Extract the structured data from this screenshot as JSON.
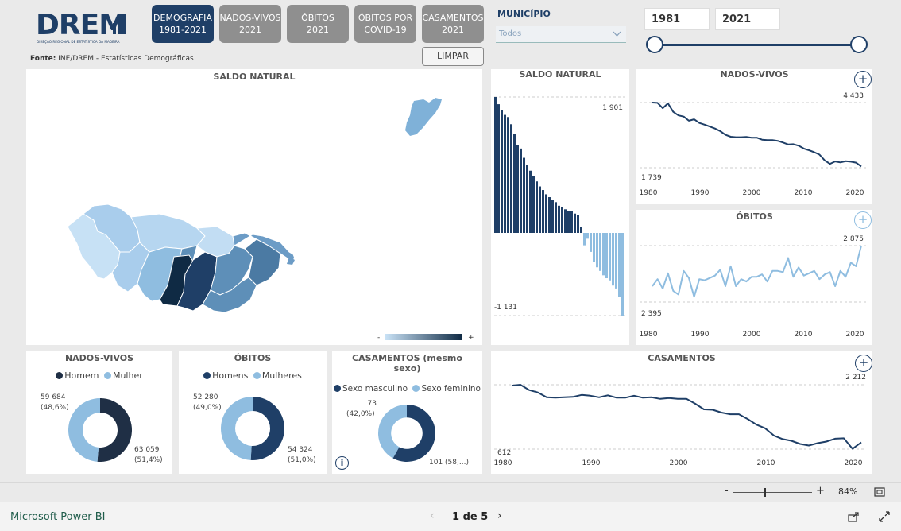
{
  "header": {
    "logo_text": "DREM",
    "logo_subtitle": "DIREÇÃO REGIONAL DE ESTATÍSTICA DA MADEIRA",
    "source_label": "Fonte:",
    "source_text": "INE/DREM - Estatísticas Demográficas",
    "nav": [
      {
        "label": "DEMOGRAFIA\n1981-2021",
        "active": true
      },
      {
        "label": "NADOS-VIVOS\n2021",
        "active": false
      },
      {
        "label": "ÓBITOS\n2021",
        "active": false
      },
      {
        "label": "ÓBITOS POR\nCOVID-19",
        "active": false
      },
      {
        "label": "CASAMENTOS\n2021",
        "active": false
      }
    ],
    "clear_label": "LIMPAR",
    "municipio_label": "MUNICÍPIO",
    "municipio_value": "Todos",
    "year_from": "1981",
    "year_to": "2021"
  },
  "map": {
    "title": "SALDO NATURAL",
    "legend_min": "-",
    "legend_max": "+",
    "colors": {
      "light": "#c9e2f6",
      "dark": "#0f2a44"
    }
  },
  "saldo": {
    "title": "SALDO NATURAL",
    "max_label": "1 901",
    "min_label": "-1 131"
  },
  "nados": {
    "title": "NADOS-VIVOS",
    "max_label": "4 433",
    "min_label": "1 739",
    "xticks": [
      "1980",
      "1990",
      "2000",
      "2010",
      "2020"
    ]
  },
  "obitos": {
    "title": "ÓBITOS",
    "max_label": "2 875",
    "min_label": "2 395",
    "xticks": [
      "1980",
      "1990",
      "2000",
      "2010",
      "2020"
    ]
  },
  "casamentos": {
    "title": "CASAMENTOS",
    "max_label": "2 212",
    "min_label": "612",
    "xticks": [
      "1980",
      "1990",
      "2000",
      "2010",
      "2020"
    ]
  },
  "donut_nados": {
    "title": "NADOS-VIVOS",
    "legend": [
      "Homem",
      "Mulher"
    ],
    "left_value": "59 684",
    "left_pct": "(48,6%)",
    "right_value": "63 059",
    "right_pct": "(51,4%)"
  },
  "donut_obitos": {
    "title": "ÓBITOS",
    "legend": [
      "Homens",
      "Mulheres"
    ],
    "left_value": "52 280",
    "left_pct": "(49,0%)",
    "right_value": "54 324",
    "right_pct": "(51,0%)"
  },
  "donut_casamentos": {
    "title": "CASAMENTOS (mesmo sexo)",
    "legend": [
      "Sexo masculino",
      "Sexo feminino"
    ],
    "left_value": "73",
    "left_pct": "(42,0%)",
    "right_value": "101 (58,...)"
  },
  "footer": {
    "brand": "Microsoft Power BI",
    "page": "1 de 5",
    "zoom": "84%"
  },
  "colors": {
    "dark": "#1f3f67",
    "light": "#8fbde0",
    "grey_btn": "#8f8f8f"
  },
  "chart_data": [
    {
      "type": "bar",
      "title": "SALDO NATURAL",
      "x": [
        1981,
        1982,
        1983,
        1984,
        1985,
        1986,
        1987,
        1988,
        1989,
        1990,
        1991,
        1992,
        1993,
        1994,
        1995,
        1996,
        1997,
        1998,
        1999,
        2000,
        2001,
        2002,
        2003,
        2004,
        2005,
        2006,
        2007,
        2008,
        2009,
        2010,
        2011,
        2012,
        2013,
        2014,
        2015,
        2016,
        2017,
        2018,
        2019,
        2020,
        2021
      ],
      "values": [
        1901,
        1800,
        1720,
        1650,
        1620,
        1520,
        1380,
        1230,
        1180,
        1050,
        950,
        870,
        790,
        720,
        650,
        600,
        540,
        500,
        460,
        430,
        380,
        360,
        330,
        310,
        300,
        270,
        250,
        80,
        -170,
        -80,
        -260,
        -400,
        -470,
        -520,
        -580,
        -620,
        -650,
        -720,
        -760,
        -880,
        -1131
      ],
      "ylim": [
        -1131,
        1901
      ]
    },
    {
      "type": "line",
      "title": "NADOS-VIVOS",
      "x": [
        1981,
        1982,
        1983,
        1984,
        1985,
        1986,
        1987,
        1988,
        1989,
        1990,
        1991,
        1992,
        1993,
        1994,
        1995,
        1996,
        1997,
        1998,
        1999,
        2000,
        2001,
        2002,
        2003,
        2004,
        2005,
        2006,
        2007,
        2008,
        2009,
        2010,
        2011,
        2012,
        2013,
        2014,
        2015,
        2016,
        2017,
        2018,
        2019,
        2020,
        2021
      ],
      "values": [
        4433,
        4420,
        4200,
        4400,
        4050,
        3900,
        3850,
        3680,
        3740,
        3590,
        3520,
        3440,
        3360,
        3250,
        3100,
        3020,
        3000,
        3000,
        3010,
        2980,
        2980,
        2900,
        2880,
        2880,
        2850,
        2780,
        2700,
        2710,
        2650,
        2530,
        2460,
        2380,
        2280,
        2040,
        1900,
        2000,
        1960,
        2010,
        1990,
        1950,
        1790
      ],
      "ylim": [
        1739,
        4433
      ]
    },
    {
      "type": "line",
      "title": "ÓBITOS",
      "x": [
        1981,
        1982,
        1983,
        1984,
        1985,
        1986,
        1987,
        1988,
        1989,
        1990,
        1991,
        1992,
        1993,
        1994,
        1995,
        1996,
        1997,
        1998,
        1999,
        2000,
        2001,
        2002,
        2003,
        2004,
        2005,
        2006,
        2007,
        2008,
        2009,
        2010,
        2011,
        2012,
        2013,
        2014,
        2015,
        2016,
        2017,
        2018,
        2019,
        2020,
        2021
      ],
      "values": [
        2530,
        2590,
        2510,
        2640,
        2490,
        2460,
        2660,
        2600,
        2440,
        2590,
        2580,
        2600,
        2620,
        2670,
        2530,
        2700,
        2530,
        2590,
        2570,
        2610,
        2610,
        2630,
        2570,
        2660,
        2660,
        2650,
        2770,
        2610,
        2690,
        2620,
        2640,
        2660,
        2590,
        2630,
        2650,
        2530,
        2660,
        2610,
        2730,
        2700,
        2875
      ],
      "ylim": [
        2395,
        2875
      ]
    },
    {
      "type": "line",
      "title": "CASAMENTOS",
      "x": [
        1981,
        1982,
        1983,
        1984,
        1985,
        1986,
        1987,
        1988,
        1989,
        1990,
        1991,
        1992,
        1993,
        1994,
        1995,
        1996,
        1997,
        1998,
        1999,
        2000,
        2001,
        2002,
        2003,
        2004,
        2005,
        2006,
        2007,
        2008,
        2009,
        2010,
        2011,
        2012,
        2013,
        2014,
        2015,
        2016,
        2017,
        2018,
        2019,
        2020,
        2021
      ],
      "values": [
        2190,
        2212,
        2080,
        2020,
        1900,
        1890,
        1900,
        1910,
        1960,
        1940,
        1900,
        1950,
        1890,
        1890,
        1940,
        1890,
        1900,
        1860,
        1880,
        1860,
        1860,
        1740,
        1600,
        1590,
        1520,
        1480,
        1480,
        1360,
        1220,
        1130,
        950,
        860,
        820,
        740,
        700,
        760,
        800,
        870,
        880,
        620,
        780
      ],
      "ylim": [
        612,
        2212
      ]
    },
    {
      "type": "pie",
      "title": "NADOS-VIVOS",
      "categories": [
        "Homem",
        "Mulher"
      ],
      "values": [
        63059,
        59684
      ]
    },
    {
      "type": "pie",
      "title": "ÓBITOS",
      "categories": [
        "Homens",
        "Mulheres"
      ],
      "values": [
        54324,
        52280
      ]
    },
    {
      "type": "pie",
      "title": "CASAMENTOS (mesmo sexo)",
      "categories": [
        "Sexo masculino",
        "Sexo feminino"
      ],
      "values": [
        101,
        73
      ]
    }
  ]
}
